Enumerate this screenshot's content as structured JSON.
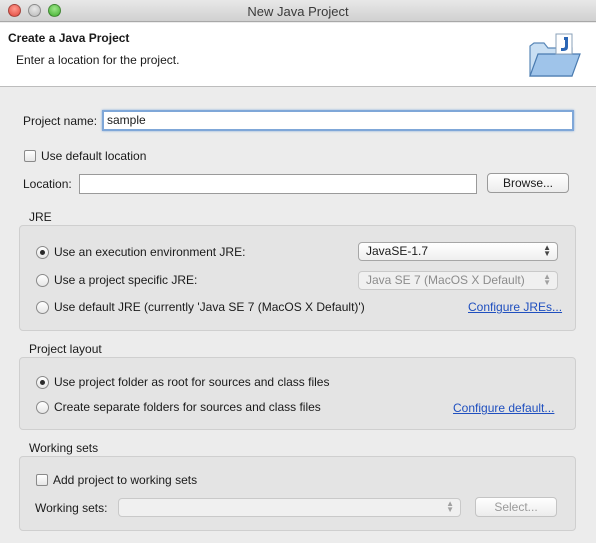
{
  "window": {
    "title": "New Java Project"
  },
  "banner": {
    "title": "Create a Java Project",
    "description": "Enter a location for the project."
  },
  "project_name": {
    "label": "Project name:",
    "value": "sample"
  },
  "default_location": {
    "label": "Use default location",
    "checked": false
  },
  "location": {
    "label": "Location:",
    "value": "",
    "browse_label": "Browse..."
  },
  "jre": {
    "group_label": "JRE",
    "option_env": "Use an execution environment JRE:",
    "env_value": "JavaSE-1.7",
    "option_specific": "Use a project specific JRE:",
    "specific_value": "Java SE 7 (MacOS X Default)",
    "option_default": "Use default JRE (currently 'Java SE 7 (MacOS X Default)')",
    "configure_link": "Configure JREs..."
  },
  "layout": {
    "group_label": "Project layout",
    "option_root": "Use project folder as root for sources and class files",
    "option_separate": "Create separate folders for sources and class files",
    "configure_link": "Configure default..."
  },
  "working_sets": {
    "group_label": "Working sets",
    "add_label": "Add project to working sets",
    "sets_label": "Working sets:",
    "sets_value": "",
    "select_label": "Select..."
  },
  "icons": {
    "banner": "java-folder-icon"
  }
}
